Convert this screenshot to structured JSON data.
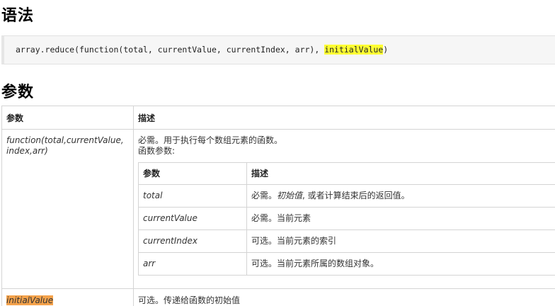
{
  "syntax": {
    "title": "语法",
    "code_prefix": "array.reduce(function(total, currentValue, currentIndex, arr), ",
    "code_highlight": "initialValue",
    "code_suffix": ")"
  },
  "params": {
    "title": "参数",
    "header_param": "参数",
    "header_desc": "描述",
    "fn_row": {
      "name": "function(total,currentValue, index,arr)",
      "desc_line1": "必需。用于执行每个数组元素的函数。",
      "desc_line2": "函数参数:",
      "inner_header_param": "参数",
      "inner_header_desc": "描述",
      "inner_rows": [
        {
          "name": "total",
          "desc_prefix": "必需。",
          "desc_italic": "初始值",
          "desc_suffix": ", 或者计算结束后的返回值。"
        },
        {
          "name": "currentValue",
          "desc": "必需。当前元素"
        },
        {
          "name": "currentIndex",
          "desc": "可选。当前元素的索引"
        },
        {
          "name": "arr",
          "desc": "可选。当前元素所属的数组对象。"
        }
      ]
    },
    "init_row": {
      "name": "initialValue",
      "desc": "可选。传递给函数的初始值"
    }
  }
}
